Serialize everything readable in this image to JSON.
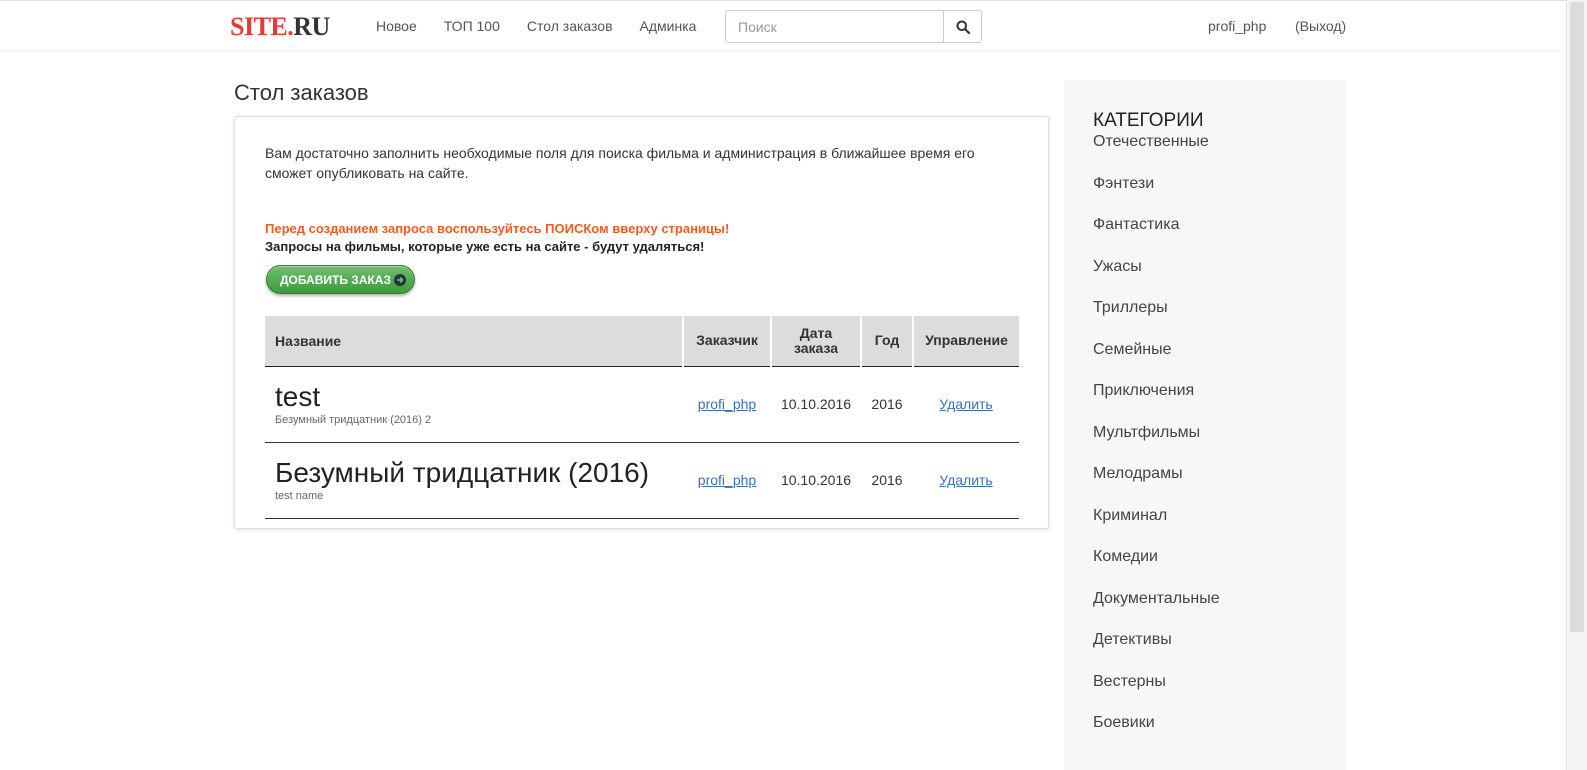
{
  "header": {
    "logo_part1": "SITE.",
    "logo_part2": "RU",
    "nav": [
      "Новое",
      "ТОП 100",
      "Стол заказов",
      "Админка"
    ],
    "search_placeholder": "Поиск",
    "user": "profi_php",
    "logout": "(Выход)"
  },
  "main": {
    "page_title": "Стол заказов",
    "intro": "Вам достаточно заполнить необходимые поля для поиска фильма и администрация в ближайшее время его сможет опубликовать на сайте.",
    "warning": "Перед созданием запроса воспользуйтесь ПОИСКом вверху страницы!",
    "note": "Запросы на фильмы, которые уже есть на сайте - будут удаляться!",
    "add_button": "ДОБАВИТЬ ЗАКАЗ",
    "table": {
      "columns": [
        "Название",
        "Заказчик",
        "Дата заказа",
        "Год",
        "Управление"
      ],
      "rows": [
        {
          "title": "test",
          "subtitle": "Безумный тридцатник (2016) 2",
          "customer": "profi_php",
          "date": "10.10.2016",
          "year": "2016",
          "action": "Удалить"
        },
        {
          "title": "Безумный тридцатник (2016)",
          "subtitle": "test name",
          "customer": "profi_php",
          "date": "10.10.2016",
          "year": "2016",
          "action": "Удалить"
        }
      ]
    }
  },
  "sidebar": {
    "title": "КАТЕГОРИИ",
    "categories": [
      "Отечественные",
      "Фэнтези",
      "Фантастика",
      "Ужасы",
      "Триллеры",
      "Семейные",
      "Приключения",
      "Мультфильмы",
      "Мелодрамы",
      "Криминал",
      "Комедии",
      "Документальные",
      "Детективы",
      "Вестерны",
      "Боевики"
    ]
  },
  "colors": {
    "logo_red": "#e83a33",
    "warning_orange": "#ef5d23",
    "button_green": "#3d9a3b",
    "link_blue": "#3a70b5"
  },
  "icons": {
    "search": "search-icon",
    "button_arrow": "arrow-right-circle-icon"
  }
}
